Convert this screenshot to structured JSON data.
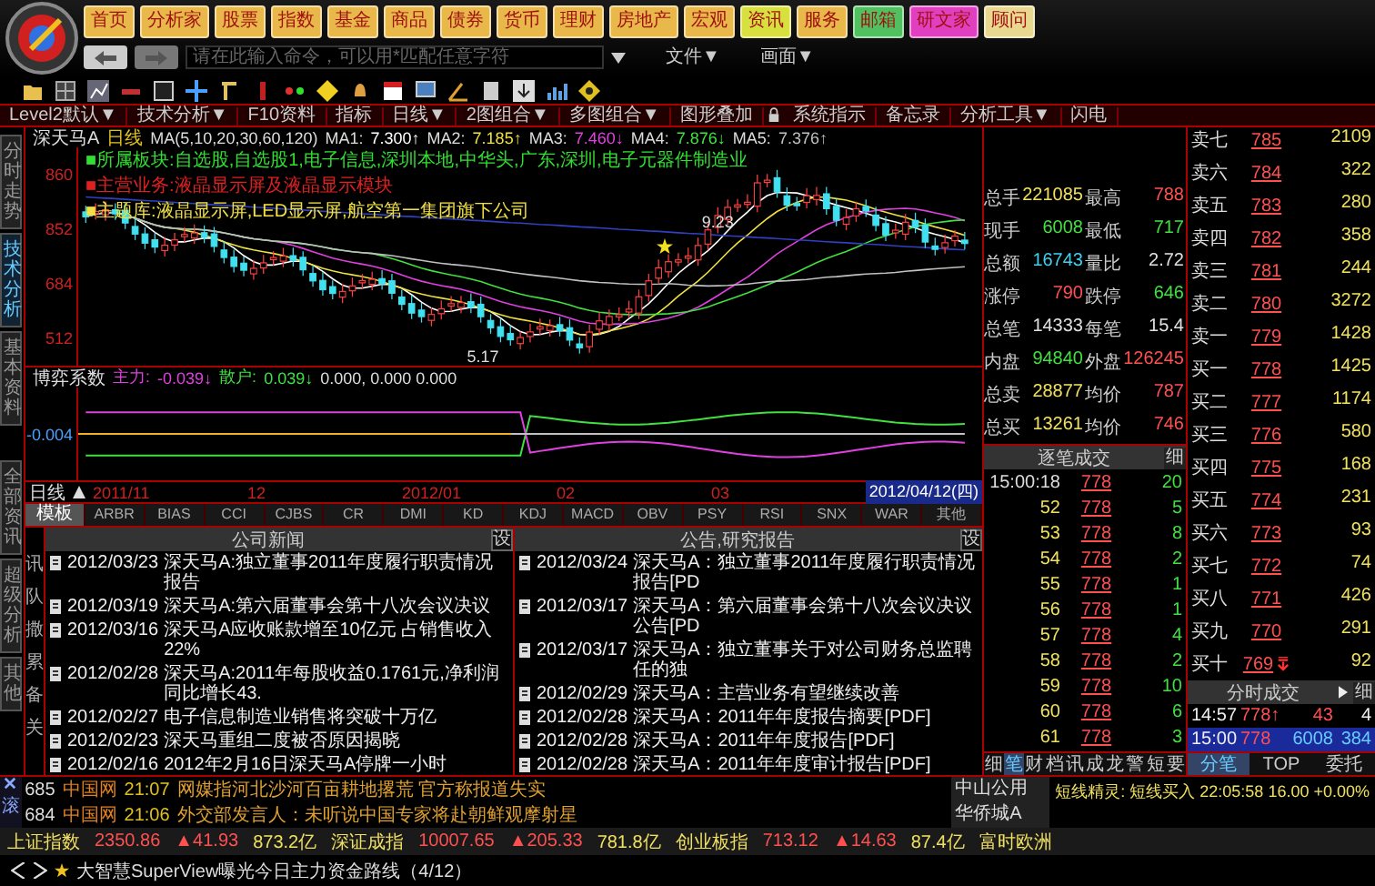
{
  "menu_buttons": [
    {
      "label": "首页",
      "color": "#e8b84a"
    },
    {
      "label": "分析家",
      "color": "#e8b84a"
    },
    {
      "label": "股票",
      "color": "#e8b84a"
    },
    {
      "label": "指数",
      "color": "#e8b84a"
    },
    {
      "label": "基金",
      "color": "#e8b84a"
    },
    {
      "label": "商品",
      "color": "#e8b84a"
    },
    {
      "label": "债券",
      "color": "#e8b84a"
    },
    {
      "label": "货币",
      "color": "#e8b84a"
    },
    {
      "label": "理财",
      "color": "#e8b84a"
    },
    {
      "label": "房地产",
      "color": "#e8b84a"
    },
    {
      "label": "宏观",
      "color": "#e8b84a"
    },
    {
      "label": "资讯",
      "color": "#d8e040"
    },
    {
      "label": "服务",
      "color": "#e8b84a"
    },
    {
      "label": "邮箱",
      "color": "#50c060"
    },
    {
      "label": "研文家",
      "color": "#e040c0"
    },
    {
      "label": "顾问",
      "color": "#e8d890"
    }
  ],
  "command_bar": {
    "placeholder": "请在此输入命令，可以用*匹配任意字符",
    "menus": [
      "文件▼",
      "画面▼"
    ]
  },
  "function_tabs": [
    "Level2默认▼",
    "技术分析▼",
    "F10资料",
    "指标",
    "日线▼",
    "2图组合▼",
    "多图组合▼",
    "图形叠加",
    "系统指示",
    "备忘录",
    "分析工具▼",
    "闪电"
  ],
  "side_tabs": [
    {
      "label": "分时走势",
      "selected": false
    },
    {
      "label": "技术分析",
      "selected": true
    },
    {
      "label": "基本资料",
      "selected": false
    }
  ],
  "side_tabs_lower": [
    {
      "label": "全部资讯",
      "selected": false
    },
    {
      "label": "超级分析",
      "selected": false
    },
    {
      "label": "其他",
      "selected": false
    }
  ],
  "chart": {
    "stock": "深天马A",
    "period": "日线",
    "ma_params": "MA(5,10,20,30,60,120)",
    "ma_values": [
      {
        "label": "MA1:",
        "value": "7.300↑",
        "color": "#ffffff"
      },
      {
        "label": "MA2:",
        "value": "7.185↑",
        "color": "#f0e040"
      },
      {
        "label": "MA3:",
        "value": "7.460↓",
        "color": "#e040e0"
      },
      {
        "label": "MA4:",
        "value": "7.876↓",
        "color": "#40e040"
      },
      {
        "label": "MA5:",
        "value": "7.376↑",
        "color": "#c0c0c0"
      }
    ],
    "price_labels": [
      "860",
      "852",
      "684",
      "512"
    ],
    "info_lines": [
      {
        "label": "■所属板块:",
        "text": "自选股,自选股1,电子信息,深圳本地,中华头,广东,深圳,电子元器件制造业",
        "color": "#30e030"
      },
      {
        "label": "■主营业务:",
        "text": "液晶显示屏及液晶显示模块",
        "color": "#e02020"
      },
      {
        "label": "■主题库:",
        "text": "液晶显示屏,LED显示屏,航空第一集团旗下公司",
        "color": "#f0e040"
      }
    ],
    "peak_label": "9.23",
    "low_label": "5.17"
  },
  "indicator": {
    "name": "博弈系数",
    "values": [
      {
        "label": "主力:",
        "value": "-0.039↓",
        "color": "#e040e0"
      },
      {
        "label": "散户:",
        "value": "0.039↓",
        "color": "#40e040"
      }
    ],
    "extra": "0.000, 0.000 0.000",
    "axis_label": "-0.004"
  },
  "date_axis": {
    "period": "日线",
    "dates": [
      "2011/11",
      "12",
      "2012/01",
      "02",
      "03"
    ],
    "current": "2012/04/12(四)"
  },
  "indicator_tabs": [
    {
      "label": "模板",
      "selected": true
    },
    {
      "label": "ARBR",
      "selected": false
    },
    {
      "label": "BIAS",
      "selected": false
    },
    {
      "label": "CCI",
      "selected": false
    },
    {
      "label": "CJBS",
      "selected": false
    },
    {
      "label": "CR",
      "selected": false
    },
    {
      "label": "DMI",
      "selected": false
    },
    {
      "label": "KD",
      "selected": false
    },
    {
      "label": "KDJ",
      "selected": false
    },
    {
      "label": "MACD",
      "selected": false
    },
    {
      "label": "OBV",
      "selected": false
    },
    {
      "label": "PSY",
      "selected": false
    },
    {
      "label": "RSI",
      "selected": false
    },
    {
      "label": "SNX",
      "selected": false
    },
    {
      "label": "WAR",
      "selected": false
    },
    {
      "label": "其他",
      "selected": false
    }
  ],
  "news": {
    "side_letters": [
      "讯",
      "队",
      "撒",
      "累",
      "备",
      "关"
    ],
    "columns": [
      {
        "title": "公司新闻",
        "setting": "设",
        "items": [
          {
            "date": "2012/03/23",
            "title": "深天马A:独立董事2011年度履行职责情况报告"
          },
          {
            "date": "2012/03/19",
            "title": "深天马A:第六届董事会第十八次会议决议"
          },
          {
            "date": "2012/03/16",
            "title": "深天马A应收账款增至10亿元 占销售收入22%"
          },
          {
            "date": "2012/02/28",
            "title": "深天马A:2011年每股收益0.1761元,净利润同比增长43."
          },
          {
            "date": "2012/02/27",
            "title": "电子信息制造业销售将突破十万亿"
          },
          {
            "date": "2012/02/23",
            "title": "深天马重组二度被否原因揭晓"
          },
          {
            "date": "2012/02/16",
            "title": "2012年2月16日深天马A停牌一小时"
          }
        ]
      },
      {
        "title": "公告,研究报告",
        "setting": "设",
        "items": [
          {
            "date": "2012/03/24",
            "title": "深天马A：独立董事2011年度履行职责情况报告[PD"
          },
          {
            "date": "2012/03/17",
            "title": "深天马A：第六届董事会第十八次会议决议公告[PD"
          },
          {
            "date": "2012/03/17",
            "title": "深天马A：独立董事关于对公司财务总监聘任的独"
          },
          {
            "date": "2012/02/29",
            "title": "深天马A：主营业务有望继续改善"
          },
          {
            "date": "2012/02/28",
            "title": "深天马A：2011年年度报告摘要[PDF]"
          },
          {
            "date": "2012/02/28",
            "title": "深天马A：2011年年度报告[PDF]"
          },
          {
            "date": "2012/02/28",
            "title": "深天马A：2011年年度审计报告[PDF]"
          }
        ]
      }
    ]
  },
  "quote_stats": [
    {
      "label": "总手",
      "value": "221085",
      "color": "#f0e060"
    },
    {
      "label": "最高",
      "value": "788",
      "color": "#ff5050"
    },
    {
      "label": "现手",
      "value": "6008",
      "color": "#40e040"
    },
    {
      "label": "最低",
      "value": "717",
      "color": "#40e040"
    },
    {
      "label": "总额",
      "value": "16743",
      "color": "#40d0f0"
    },
    {
      "label": "量比",
      "value": "2.72",
      "color": "#e0e0e0"
    },
    {
      "label": "涨停",
      "value": "790",
      "color": "#ff5050"
    },
    {
      "label": "跌停",
      "value": "646",
      "color": "#40e040"
    },
    {
      "label": "总笔",
      "value": "14333",
      "color": "#e0e0e0"
    },
    {
      "label": "每笔",
      "value": "15.4",
      "color": "#e0e0e0"
    },
    {
      "label": "内盘",
      "value": "94840",
      "color": "#40e040"
    },
    {
      "label": "外盘",
      "value": "126245",
      "color": "#ff5050"
    },
    {
      "label": "总卖",
      "value": "28877",
      "color": "#f0e060"
    },
    {
      "label": "均价",
      "value": "787",
      "color": "#ff5050"
    },
    {
      "label": "总买",
      "value": "13261",
      "color": "#f0e060"
    },
    {
      "label": "均价",
      "value": "746",
      "color": "#ff5050"
    }
  ],
  "order_book": [
    {
      "label": "卖七",
      "price": "785",
      "volume": "2109",
      "flag": false
    },
    {
      "label": "卖六",
      "price": "784",
      "volume": "322",
      "flag": false
    },
    {
      "label": "卖五",
      "price": "783",
      "volume": "280",
      "flag": false
    },
    {
      "label": "卖四",
      "price": "782",
      "volume": "358",
      "flag": false
    },
    {
      "label": "卖三",
      "price": "781",
      "volume": "244",
      "flag": false
    },
    {
      "label": "卖二",
      "price": "780",
      "volume": "3272",
      "flag": false
    },
    {
      "label": "卖一",
      "price": "779",
      "volume": "1428",
      "flag": false
    },
    {
      "label": "买一",
      "price": "778",
      "volume": "1425",
      "flag": false
    },
    {
      "label": "买二",
      "price": "777",
      "volume": "1174",
      "flag": false
    },
    {
      "label": "买三",
      "price": "776",
      "volume": "580",
      "flag": false
    },
    {
      "label": "买四",
      "price": "775",
      "volume": "168",
      "flag": false
    },
    {
      "label": "买五",
      "price": "774",
      "volume": "231",
      "flag": false
    },
    {
      "label": "买六",
      "price": "773",
      "volume": "93",
      "flag": false
    },
    {
      "label": "买七",
      "price": "772",
      "volume": "74",
      "flag": false
    },
    {
      "label": "买八",
      "price": "771",
      "volume": "426",
      "flag": false
    },
    {
      "label": "买九",
      "price": "770",
      "volume": "291",
      "flag": false
    },
    {
      "label": "买十",
      "price": "769",
      "volume": "92",
      "flag": true
    }
  ],
  "ticks": {
    "title": "逐笔成交",
    "detail": "细",
    "rows": [
      {
        "time": "15:00:18",
        "price": "778",
        "volume": "20"
      },
      {
        "time": "52",
        "price": "778",
        "volume": "5"
      },
      {
        "time": "53",
        "price": "778",
        "volume": "8"
      },
      {
        "time": "54",
        "price": "778",
        "volume": "2"
      },
      {
        "time": "55",
        "price": "778",
        "volume": "1"
      },
      {
        "time": "56",
        "price": "778",
        "volume": "1"
      },
      {
        "time": "57",
        "price": "778",
        "volume": "4"
      },
      {
        "time": "58",
        "price": "778",
        "volume": "2"
      },
      {
        "time": "59",
        "price": "778",
        "volume": "10"
      },
      {
        "time": "60",
        "price": "778",
        "volume": "6"
      },
      {
        "time": "61",
        "price": "778",
        "volume": "3"
      }
    ]
  },
  "minute_trades": {
    "title": "分时成交",
    "detail": "细",
    "rows": [
      {
        "time": "14:57",
        "price": "778↑",
        "volume": "43",
        "count": "4",
        "selected": false
      },
      {
        "time": "15:00",
        "price": "778",
        "volume": "6008",
        "count": "384",
        "selected": true
      }
    ]
  },
  "left_bottom_tabs": [
    {
      "label": "细",
      "selected": false
    },
    {
      "label": "笔",
      "selected": true
    },
    {
      "label": "财",
      "selected": false
    },
    {
      "label": "档",
      "selected": false
    },
    {
      "label": "讯",
      "selected": false
    },
    {
      "label": "成",
      "selected": false
    },
    {
      "label": "龙",
      "selected": false
    },
    {
      "label": "警",
      "selected": false
    },
    {
      "label": "短",
      "selected": false
    },
    {
      "label": "要",
      "selected": false
    }
  ],
  "right_bottom_tabs": [
    {
      "label": "分笔",
      "selected": true
    },
    {
      "label": "TOP",
      "selected": false
    },
    {
      "label": "委托",
      "selected": false
    }
  ],
  "tickers": [
    {
      "number": "685",
      "source": "中国网",
      "time": "21:07",
      "text": "网媒指河北沙河百亩耕地撂荒 官方称报道失实"
    },
    {
      "number": "684",
      "source": "中国网",
      "time": "21:06",
      "text": "外交部发言人：未听说中国专家将赴朝鲜观摩射星"
    }
  ],
  "ticker_side_label": "滚",
  "watchlist": [
    "中山公用",
    "华侨城A"
  ],
  "alert": "短线精灵: 短线买入 22:05:58 16.00 +0.00%",
  "indices": [
    {
      "name": "上证指数",
      "value": "2350.86",
      "change": "▲41.93",
      "amount": "873.2亿"
    },
    {
      "name": "深证成指",
      "value": "10007.65",
      "change": "▲205.33",
      "amount": "781.8亿"
    },
    {
      "name": "创业板指",
      "value": "713.12",
      "change": "▲14.63",
      "amount": "87.4亿"
    },
    {
      "name": "富时欧洲"
    }
  ],
  "headline": "大智慧SuperView曝光今日主力资金路线（4/12）"
}
